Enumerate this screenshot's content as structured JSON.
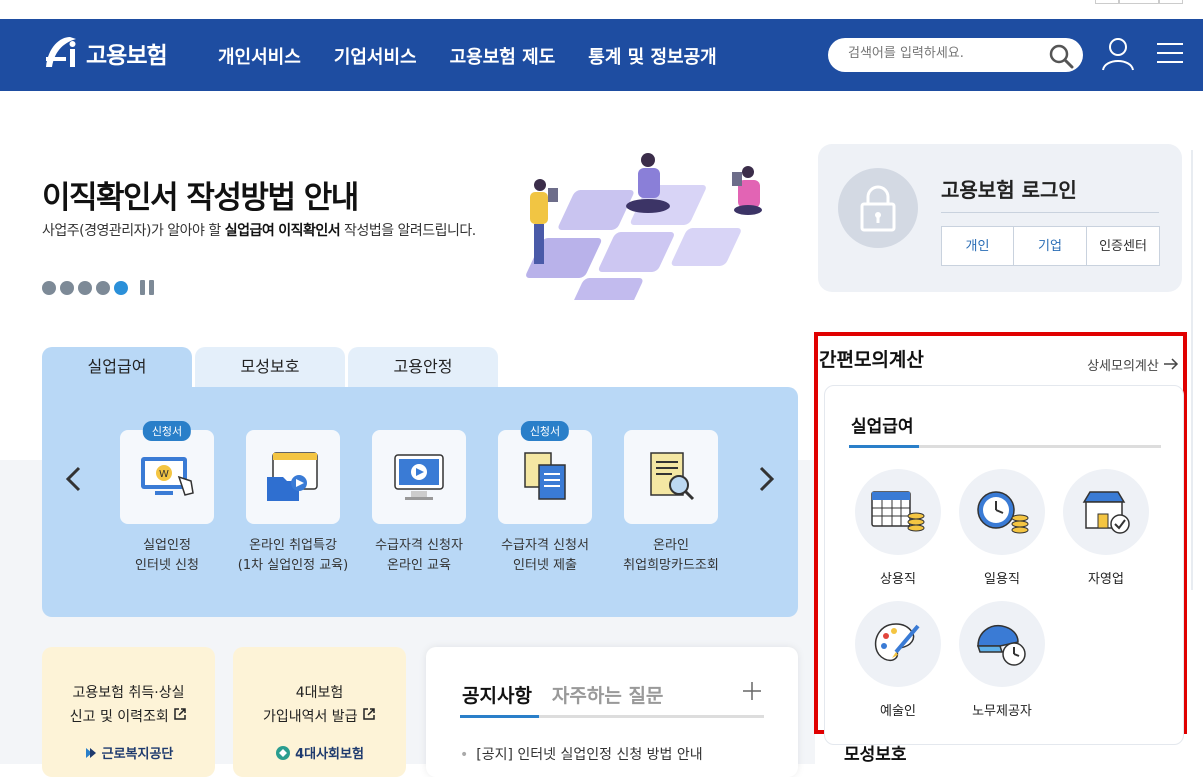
{
  "header": {
    "logo_text": "고용보험",
    "nav": [
      "개인서비스",
      "기업서비스",
      "고용보험 제도",
      "통계 및 정보공개"
    ],
    "search_placeholder": "검색어를 입력하세요.",
    "bg_color": "#1e4da1"
  },
  "hero": {
    "title": "이직확인서 작성방법 안내",
    "subtitle_pre": "사업주(경영관리자)가 알아야 할 ",
    "subtitle_b1": "실업급여",
    "subtitle_sp": " ",
    "subtitle_b2": "이직확인서",
    "subtitle_post": " 작성법을 알려드립니다.",
    "slides": 5,
    "active_slide": 5
  },
  "tabs": [
    "실업급여",
    "모성보호",
    "고용안정"
  ],
  "active_tab": "실업급여",
  "services": [
    {
      "badge": "신청서",
      "line1": "실업인정",
      "line2": "인터넷 신청",
      "icon": "computer-coin-icon"
    },
    {
      "badge": "",
      "line1": "온라인 취업특강",
      "line2": "(1차 실업인정 교육)",
      "icon": "video-folder-icon"
    },
    {
      "badge": "",
      "line1": "수급자격 신청자",
      "line2": "온라인 교육",
      "icon": "monitor-play-icon"
    },
    {
      "badge": "신청서",
      "line1": "수급자격 신청서",
      "line2": "인터넷 제출",
      "icon": "documents-icon"
    },
    {
      "badge": "",
      "line1": "온라인",
      "line2": "취업희망카드조회",
      "icon": "document-search-icon"
    }
  ],
  "cards": [
    {
      "line1": "고용보험 취득·상실",
      "line2": "신고 및 이력조회",
      "org": "근로복지공단"
    },
    {
      "line1": "4대보험",
      "line2": "가입내역서 발급",
      "org": "4대사회보험"
    }
  ],
  "notice": {
    "tab_active": "공지사항",
    "tab_other": "자주하는 질문",
    "plus": "+",
    "item": "[공지] 인터넷 실업인정 신청 방법 안내"
  },
  "login": {
    "title": "고용보험 로그인",
    "buttons": [
      "개인",
      "기업",
      "인증센터"
    ]
  },
  "calc": {
    "title": "간편모의계산",
    "more": "상세모의계산",
    "section": "실업급여",
    "items": [
      "상용직",
      "일용직",
      "자영업",
      "예술인",
      "노무제공자"
    ],
    "next_section": "모성보호"
  }
}
